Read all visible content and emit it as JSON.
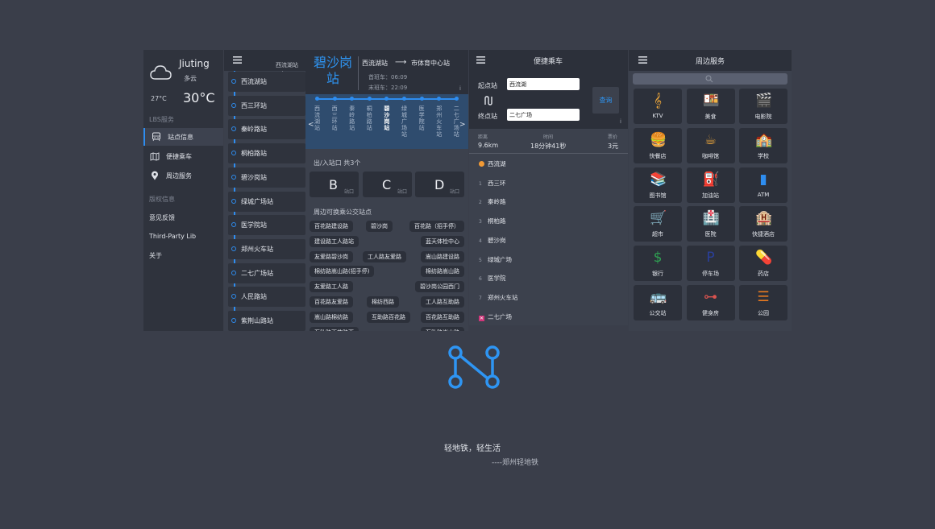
{
  "sidebar": {
    "city": "Jiuting",
    "condition": "多云",
    "temp_low": "27°C",
    "temp_high": "30°C",
    "section_lbs": "LBS服务",
    "items": [
      {
        "label": "站点信息"
      },
      {
        "label": "便捷乘车"
      },
      {
        "label": "周边服务"
      }
    ],
    "section_copyright": "版权信息",
    "links": [
      {
        "label": "意见反馈"
      },
      {
        "label": "Third-Party Lib"
      },
      {
        "label": "关于"
      }
    ]
  },
  "station_list": {
    "mini_label": "西流湖站 ⟶",
    "stations": [
      "西流湖站",
      "西三环站",
      "秦岭路站",
      "桐柏路站",
      "碧沙岗站",
      "绿城广场站",
      "医学院站",
      "郑州火车站",
      "二七广场站",
      "人民路站",
      "紫荆山路站"
    ]
  },
  "station_detail": {
    "name": "碧沙岗站",
    "route_from": "西流湖站",
    "route_arrow": "⟶",
    "route_to": "市体育中心站",
    "first_bus": "首班车：06:09",
    "last_bus": "末班车：22:09",
    "info_icon": "i",
    "strip_left": "<",
    "strip_right": ">",
    "strip_stations": [
      "西流湖站",
      "西三环站",
      "秦岭路站",
      "桐柏路站",
      "碧沙岗站",
      "绿城广场站",
      "医学院站",
      "郑州火车站",
      "二七广场站"
    ],
    "current_index": 4,
    "exits_title": "出/入站口 共3个",
    "exits": [
      {
        "letter": "B",
        "sub": "站口"
      },
      {
        "letter": "C",
        "sub": "站口"
      },
      {
        "letter": "D",
        "sub": "站口"
      }
    ],
    "bus_title": "周边可换乘公交站点",
    "bus_stops": [
      "百花路建设路",
      "碧沙岗",
      "百花路（招手停）",
      "建设路工人路站",
      "蓝天体检中心",
      "友爱路碧沙岗",
      "工人路友爱路",
      "嵩山路建设路",
      "棉纺路嵩山路(招手停)",
      "棉纺路嵩山路",
      "友爱路工人路",
      "碧沙岗公园西门",
      "百花路友爱路",
      "棉纺西路",
      "工人路互助路",
      "嵩山路棉纺路",
      "互助路百花路",
      "百花路互助路",
      "互助路百花路西",
      "互助路嵩山路"
    ]
  },
  "ride": {
    "title": "便捷乘车",
    "from_label": "起点站",
    "from_value": "西流湖",
    "to_label": "终点站",
    "to_value": "二七广场",
    "query_label": "查询",
    "info_icon": "i",
    "distance_label": "距离",
    "distance_value": "9.6km",
    "time_label": "时间",
    "time_value": "18分钟41秒",
    "fare_label": "票价",
    "fare_value": "3元",
    "path": [
      {
        "num": "",
        "name": "西流湖"
      },
      {
        "num": "1",
        "name": "西三环"
      },
      {
        "num": "2",
        "name": "秦岭路"
      },
      {
        "num": "3",
        "name": "桐柏路"
      },
      {
        "num": "4",
        "name": "碧沙岗"
      },
      {
        "num": "5",
        "name": "绿城广场"
      },
      {
        "num": "6",
        "name": "医学院"
      },
      {
        "num": "7",
        "name": "郑州火车站"
      },
      {
        "num": "",
        "name": "二七广场"
      }
    ]
  },
  "services": {
    "title": "周边服务",
    "items": [
      {
        "label": "KTV",
        "icon": "music-note-icon",
        "glyph": "𝄞",
        "color": "#e8a33a"
      },
      {
        "label": "美食",
        "icon": "food-icon",
        "glyph": "🍱",
        "color": "#d9534f"
      },
      {
        "label": "电影院",
        "icon": "cinema-icon",
        "glyph": "🎬",
        "color": "#c9302c"
      },
      {
        "label": "快餐店",
        "icon": "burger-icon",
        "glyph": "🍔",
        "color": "#e8a33a"
      },
      {
        "label": "咖啡馆",
        "icon": "coffee-icon",
        "glyph": "☕",
        "color": "#e8a33a"
      },
      {
        "label": "学校",
        "icon": "school-icon",
        "glyph": "🏫",
        "color": "#3a9a5a"
      },
      {
        "label": "图书馆",
        "icon": "library-icon",
        "glyph": "📚",
        "color": "#d9534f"
      },
      {
        "label": "加油站",
        "icon": "gas-station-icon",
        "glyph": "⛽",
        "color": "#f0c020"
      },
      {
        "label": "ATM",
        "icon": "atm-icon",
        "glyph": "▮",
        "color": "#2e8df0"
      },
      {
        "label": "超市",
        "icon": "cart-icon",
        "glyph": "🛒",
        "color": "#3aa55a"
      },
      {
        "label": "医院",
        "icon": "hospital-icon",
        "glyph": "🏥",
        "color": "#7a3ac9"
      },
      {
        "label": "快捷酒店",
        "icon": "hotel-icon",
        "glyph": "🏨",
        "color": "#2e8df0"
      },
      {
        "label": "银行",
        "icon": "dollar-icon",
        "glyph": "$",
        "color": "#2fa052"
      },
      {
        "label": "停车场",
        "icon": "parking-icon",
        "glyph": "P",
        "color": "#2a3f9a"
      },
      {
        "label": "药店",
        "icon": "pill-icon",
        "glyph": "💊",
        "color": "#e04a8a"
      },
      {
        "label": "公交站",
        "icon": "bus-icon",
        "glyph": "🚌",
        "color": "#d9534f"
      },
      {
        "label": "健身房",
        "icon": "dumbbell-icon",
        "glyph": "⊶",
        "color": "#d9534f"
      },
      {
        "label": "公园",
        "icon": "bench-icon",
        "glyph": "☰",
        "color": "#e87a20"
      }
    ]
  },
  "footer": {
    "slogan": "轻地铁，轻生活",
    "signature": "----郑州轻地铁"
  }
}
